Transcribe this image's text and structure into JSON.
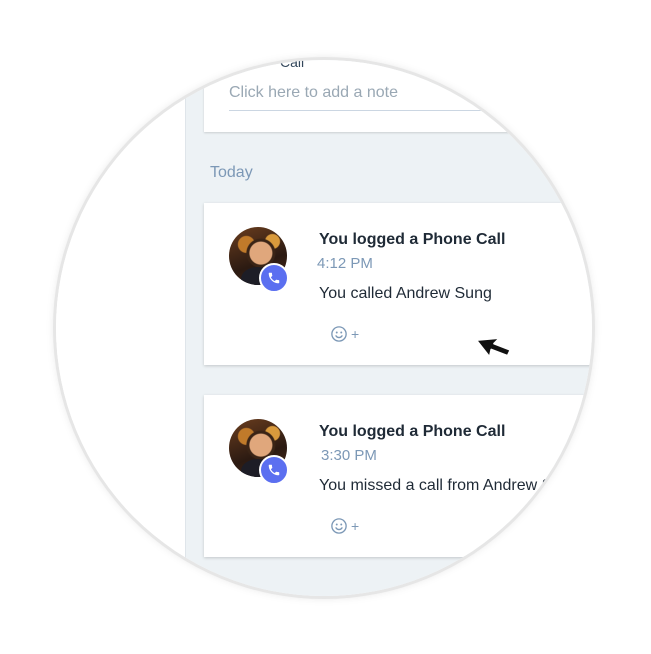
{
  "note_card": {
    "title": "Call",
    "note_placeholder": "Click here to add a note"
  },
  "section": {
    "label": "Today"
  },
  "activities": [
    {
      "title": "You logged a Phone Call",
      "time": "4:12 PM",
      "body": "You called Andrew Sung",
      "reaction_plus": "+"
    },
    {
      "title": "You logged a Phone Call",
      "time": "3:30 PM",
      "body": "You missed a call from Andrew Sung",
      "reaction_plus": "+"
    }
  ],
  "icons": {
    "avatar": "avatar",
    "badge": "phone-icon",
    "reaction": "smiley-icon",
    "cursor": "cursor-arrow-icon"
  },
  "colors": {
    "accent": "#5b6ff0",
    "feed_background": "#edf2f5",
    "muted_text": "#7c98b6"
  }
}
